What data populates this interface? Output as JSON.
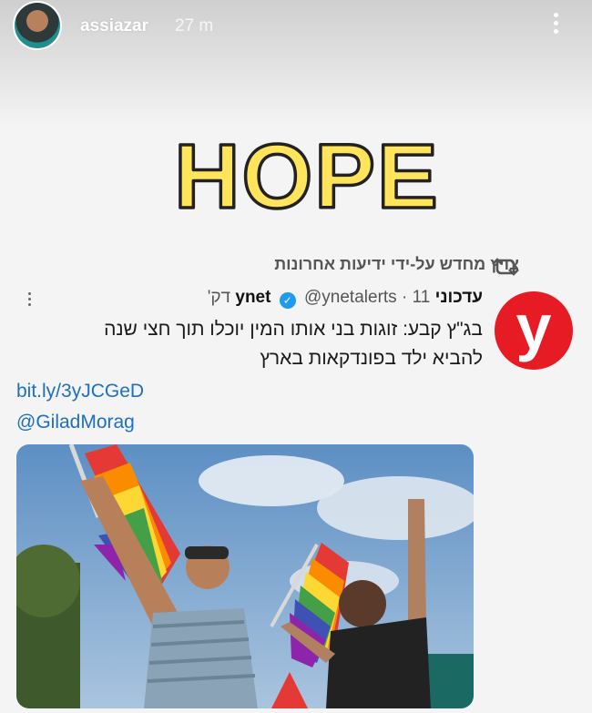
{
  "story": {
    "username": "assiazar",
    "time_ago": "27 m"
  },
  "sticker": {
    "text": "HOPE"
  },
  "tweet": {
    "retweet_text": "צויץ מחדש על-ידי ידיעות אחרונות",
    "account_name": "עדכוני ynet",
    "handle": "@ynetalerts",
    "time": "11 דק'",
    "separator": "·",
    "text_line_1": "בג\"ץ קבע: זוגות בני אותו המין יוכלו תוך חצי שנה",
    "text_line_2": "להביא ילד בפונדקאות בארץ",
    "link": "bit.ly/3yJCGeD",
    "mention": "@GiladMorag",
    "logo_letter": "y",
    "verified_mark": "✓"
  },
  "colors": {
    "ynet_red": "#e61b23",
    "link_blue": "#1f6fbf",
    "verified_blue": "#1d9bf0",
    "hope_yellow": "#ffe45c"
  }
}
